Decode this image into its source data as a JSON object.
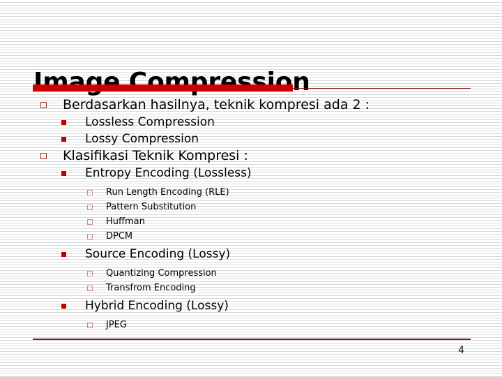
{
  "slide": {
    "title": "Image Compression",
    "page_number": "4",
    "accent_color": "#cc0000",
    "rule_color": "#7a1020",
    "bullet_level1_color": "#9c2b2b",
    "bullet_level2_color": "#c00000",
    "bullet_level3_color": "#c98d8d",
    "text_color": "#000000"
  },
  "content": {
    "lines": [
      {
        "level": 1,
        "text": "Berdasarkan hasilnya, teknik kompresi ada 2 :",
        "marker": "hollow-square-bullet"
      },
      {
        "level": 2,
        "text": "Lossless Compression",
        "marker": "filled-square-bullet"
      },
      {
        "level": 2,
        "text": "Lossy Compression",
        "marker": "filled-square-bullet"
      },
      {
        "level": 1,
        "text": "Klasifikasi Teknik Kompresi :",
        "marker": "hollow-square-bullet"
      },
      {
        "level": 2,
        "text": "Entropy Encoding (Lossless)",
        "marker": "filled-square-bullet"
      },
      {
        "level": 3,
        "text": "Run Length Encoding (RLE)",
        "marker": "hollow-square-bullet"
      },
      {
        "level": 3,
        "text": "Pattern Substitution",
        "marker": "hollow-square-bullet"
      },
      {
        "level": 3,
        "text": "Huffman",
        "marker": "hollow-square-bullet"
      },
      {
        "level": 3,
        "text": "DPCM",
        "marker": "hollow-square-bullet"
      },
      {
        "level": 2,
        "text": "Source Encoding (Lossy)",
        "marker": "filled-square-bullet"
      },
      {
        "level": 3,
        "text": "Quantizing Compression",
        "marker": "hollow-square-bullet"
      },
      {
        "level": 3,
        "text": "Transfrom Encoding",
        "marker": "hollow-square-bullet"
      },
      {
        "level": 2,
        "text": "Hybrid Encoding (Lossy)",
        "marker": "filled-square-bullet"
      },
      {
        "level": 3,
        "text": "JPEG",
        "marker": "hollow-square-bullet"
      }
    ]
  }
}
